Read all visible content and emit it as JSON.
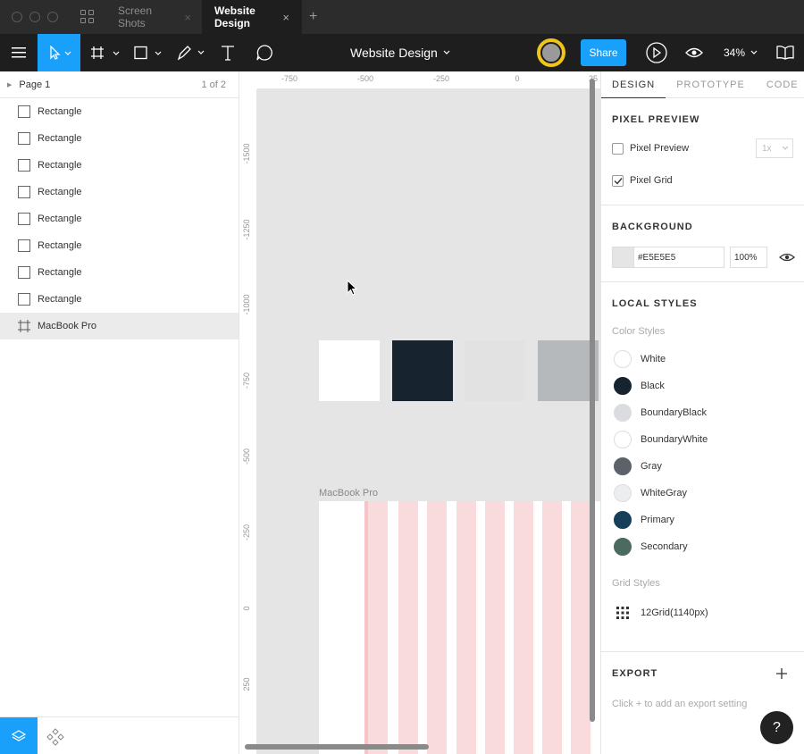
{
  "titlebar": {
    "tabs": [
      {
        "label": "Screen Shots",
        "active": false
      },
      {
        "label": "Website Design",
        "active": true
      }
    ],
    "close_glyph": "×",
    "new_tab_glyph": "+"
  },
  "toolbar": {
    "file_title": "Website Design",
    "share_label": "Share",
    "zoom_label": "34%",
    "accent": "#18A0FB"
  },
  "layers": {
    "page_name": "Page 1",
    "page_count": "1 of 2",
    "items": [
      {
        "label": "Rectangle"
      },
      {
        "label": "Rectangle"
      },
      {
        "label": "Rectangle"
      },
      {
        "label": "Rectangle"
      },
      {
        "label": "Rectangle"
      },
      {
        "label": "Rectangle"
      },
      {
        "label": "Rectangle"
      },
      {
        "label": "Rectangle"
      }
    ],
    "frame_label": "MacBook Pro"
  },
  "canvas": {
    "ruler_top": [
      "-750",
      "-500",
      "-250",
      "0",
      "25"
    ],
    "ruler_left": [
      "-1500",
      "-1250",
      "-1000",
      "-750",
      "-500",
      "-250",
      "0",
      "250"
    ],
    "frame_label": "MacBook Pro",
    "swatches": [
      "#FFFFFF",
      "#17232F",
      "#E2E2E2",
      "#B6B9BC"
    ],
    "grid_color": "#FADBDD"
  },
  "props": {
    "tabs": [
      "DESIGN",
      "PROTOTYPE",
      "CODE"
    ],
    "pixel_preview": {
      "title": "PIXEL PREVIEW",
      "preview_label": "Pixel Preview",
      "preview_checked": false,
      "scale": "1x",
      "grid_label": "Pixel Grid",
      "grid_checked": true
    },
    "background": {
      "title": "BACKGROUND",
      "hex": "#E5E5E5",
      "opacity": "100%"
    },
    "local_styles": {
      "title": "LOCAL STYLES",
      "color_styles_title": "Color Styles",
      "colors": [
        {
          "name": "White",
          "color": "#FFFFFF"
        },
        {
          "name": "Black",
          "color": "#17232F"
        },
        {
          "name": "BoundaryBlack",
          "color": "#DADCDF"
        },
        {
          "name": "BoundaryWhite",
          "color": "#FFFFFF"
        },
        {
          "name": "Gray",
          "color": "#5C6268"
        },
        {
          "name": "WhiteGray",
          "color": "#ECEEF0"
        },
        {
          "name": "Primary",
          "color": "#163F5A"
        },
        {
          "name": "Secondary",
          "color": "#4C6B60"
        }
      ],
      "grid_styles_title": "Grid Styles",
      "grid_style": "12Grid(1140px)"
    },
    "export": {
      "title": "EXPORT",
      "hint": "Click + to add an export setting"
    }
  },
  "help_label": "?"
}
